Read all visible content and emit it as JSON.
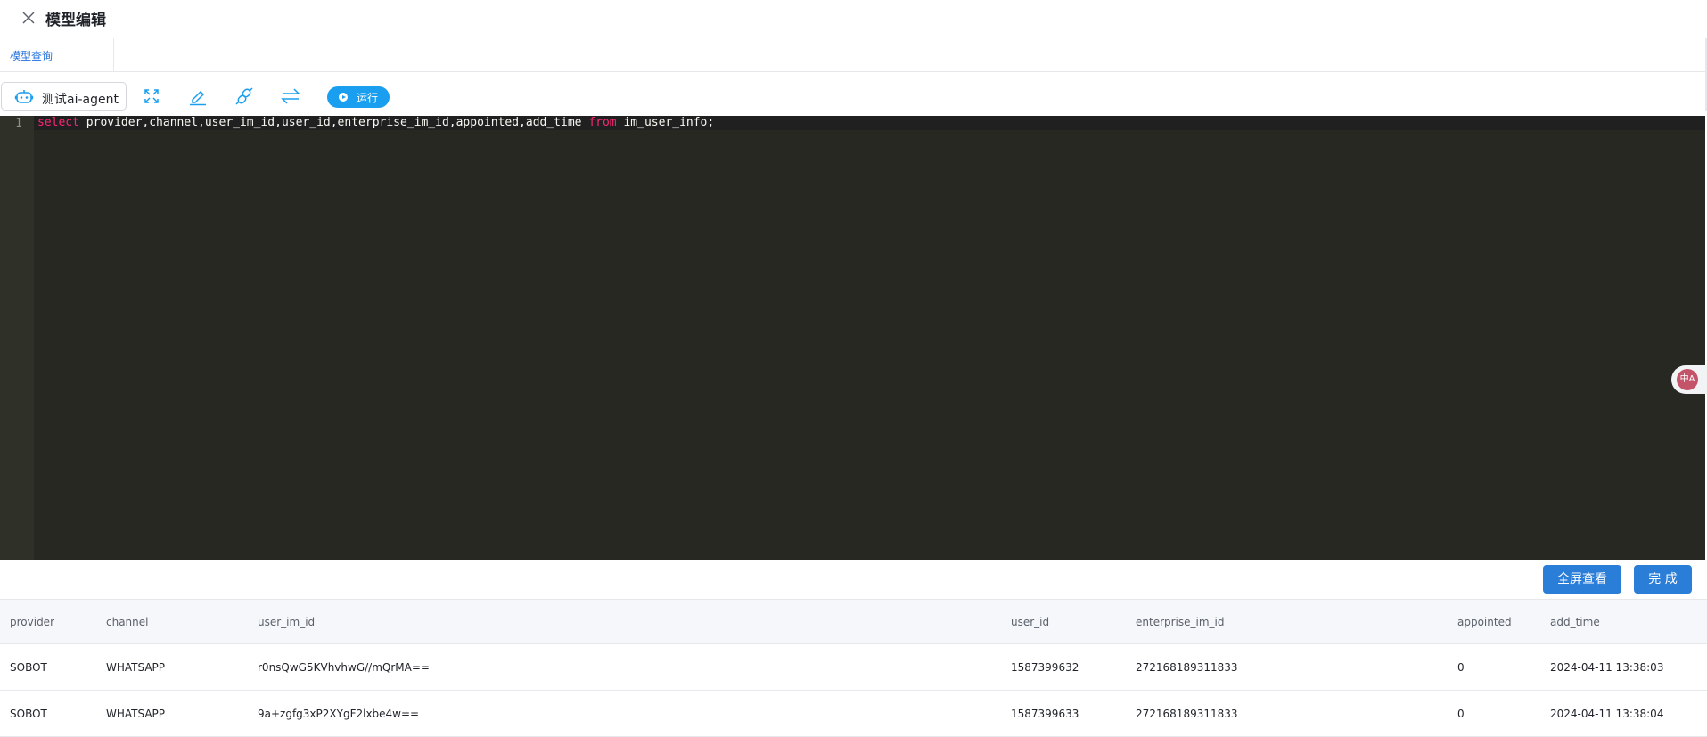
{
  "header": {
    "title": "模型编辑"
  },
  "tabs": [
    {
      "label": "模型查询"
    }
  ],
  "toolbar": {
    "agent_label": "测试ai-agent",
    "run_label": "运行",
    "icons": [
      "fullscreen-icon",
      "edit-icon",
      "link-icon",
      "swap-icon"
    ],
    "accent": "#1a9ff0"
  },
  "editor": {
    "line_numbers": [
      "1"
    ],
    "tokens": [
      {
        "text": "select",
        "kind": "keyword"
      },
      {
        "text": " provider,channel,user_im_id,user_id,enterprise_im_id,appointed,add_time ",
        "kind": "plain"
      },
      {
        "text": "from",
        "kind": "keyword"
      },
      {
        "text": " im_user_info;",
        "kind": "plain"
      }
    ]
  },
  "translate_badge": "中A",
  "actions": {
    "fullscreen_label": "全屏查看",
    "done_label": "完 成"
  },
  "table": {
    "columns": [
      "provider",
      "channel",
      "user_im_id",
      "user_id",
      "enterprise_im_id",
      "appointed",
      "add_time"
    ],
    "rows": [
      [
        "SOBOT",
        "WHATSAPP",
        "r0nsQwG5KVhvhwG//mQrMA==",
        "1587399632",
        "272168189311833",
        "0",
        "2024-04-11 13:38:03"
      ],
      [
        "SOBOT",
        "WHATSAPP",
        "9a+zgfg3xP2XYgF2lxbe4w==",
        "1587399633",
        "272168189311833",
        "0",
        "2024-04-11 13:38:04"
      ]
    ]
  }
}
